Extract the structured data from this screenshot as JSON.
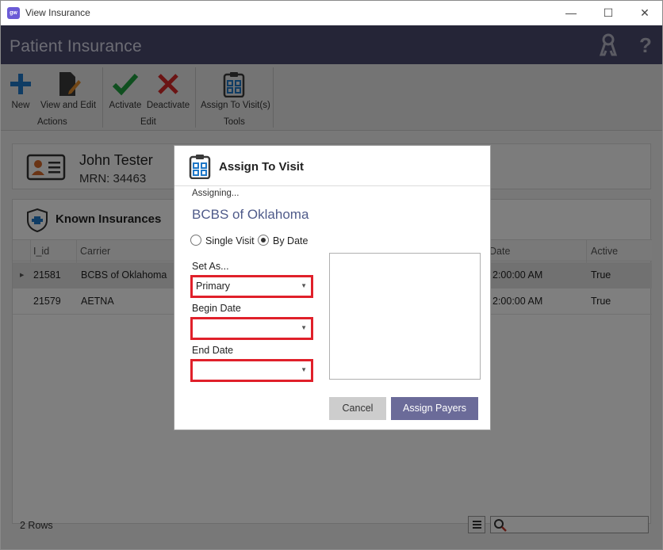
{
  "window": {
    "title": "View Insurance",
    "app_icon_text": "gw",
    "minimize_glyph": "—",
    "maximize_glyph": "☐",
    "close_glyph": "✕"
  },
  "header": {
    "title": "Patient Insurance",
    "icons": [
      "keys-icon",
      "help-icon"
    ],
    "help_glyph": "?"
  },
  "ribbon": {
    "groups": [
      {
        "label": "Actions",
        "buttons": [
          {
            "label": "New",
            "icon": "plus-icon"
          },
          {
            "label": "View and Edit",
            "icon": "edit-document-icon"
          }
        ]
      },
      {
        "label": "Edit",
        "buttons": [
          {
            "label": "Activate",
            "icon": "checkmark-icon"
          },
          {
            "label": "Deactivate",
            "icon": "x-icon"
          }
        ]
      },
      {
        "label": "Tools",
        "buttons": [
          {
            "label": "Assign To Visit(s)",
            "icon": "clipboard-checklist-icon"
          }
        ]
      }
    ]
  },
  "patient": {
    "name": "John Tester",
    "mrn": "MRN: 34463"
  },
  "insurances": {
    "title": "Known Insurances",
    "columns": {
      "id": "I_id",
      "carrier": "Carrier",
      "date": "Date",
      "active": "Active"
    },
    "rows": [
      {
        "id": "21581",
        "carrier": "BCBS of Oklahoma",
        "date": "2:00:00 AM",
        "active": "True",
        "selected": true
      },
      {
        "id": "21579",
        "carrier": "AETNA",
        "date": "2:00:00 AM",
        "active": "True",
        "selected": false
      }
    ],
    "row_count": "2 Rows",
    "search_placeholder": ""
  },
  "dialog": {
    "title": "Assign To Visit",
    "assigning_label": "Assigning...",
    "carrier": "BCBS of Oklahoma",
    "mode_options": {
      "single": "Single Visit",
      "by_date": "By Date"
    },
    "mode_selected": "by_date",
    "set_as_label": "Set As...",
    "set_as_value": "Primary",
    "begin_date_label": "Begin Date",
    "begin_date_value": "",
    "end_date_label": "End Date",
    "end_date_value": "",
    "cancel_label": "Cancel",
    "assign_label": "Assign Payers",
    "highlight_color": "#e0202a",
    "primary_button_color": "#6b6b99"
  },
  "colors": {
    "header_bg": "#4a4a6e",
    "accent_blue": "#1f78c8",
    "activate_green": "#1e9e3e",
    "deactivate_red": "#d62828"
  }
}
